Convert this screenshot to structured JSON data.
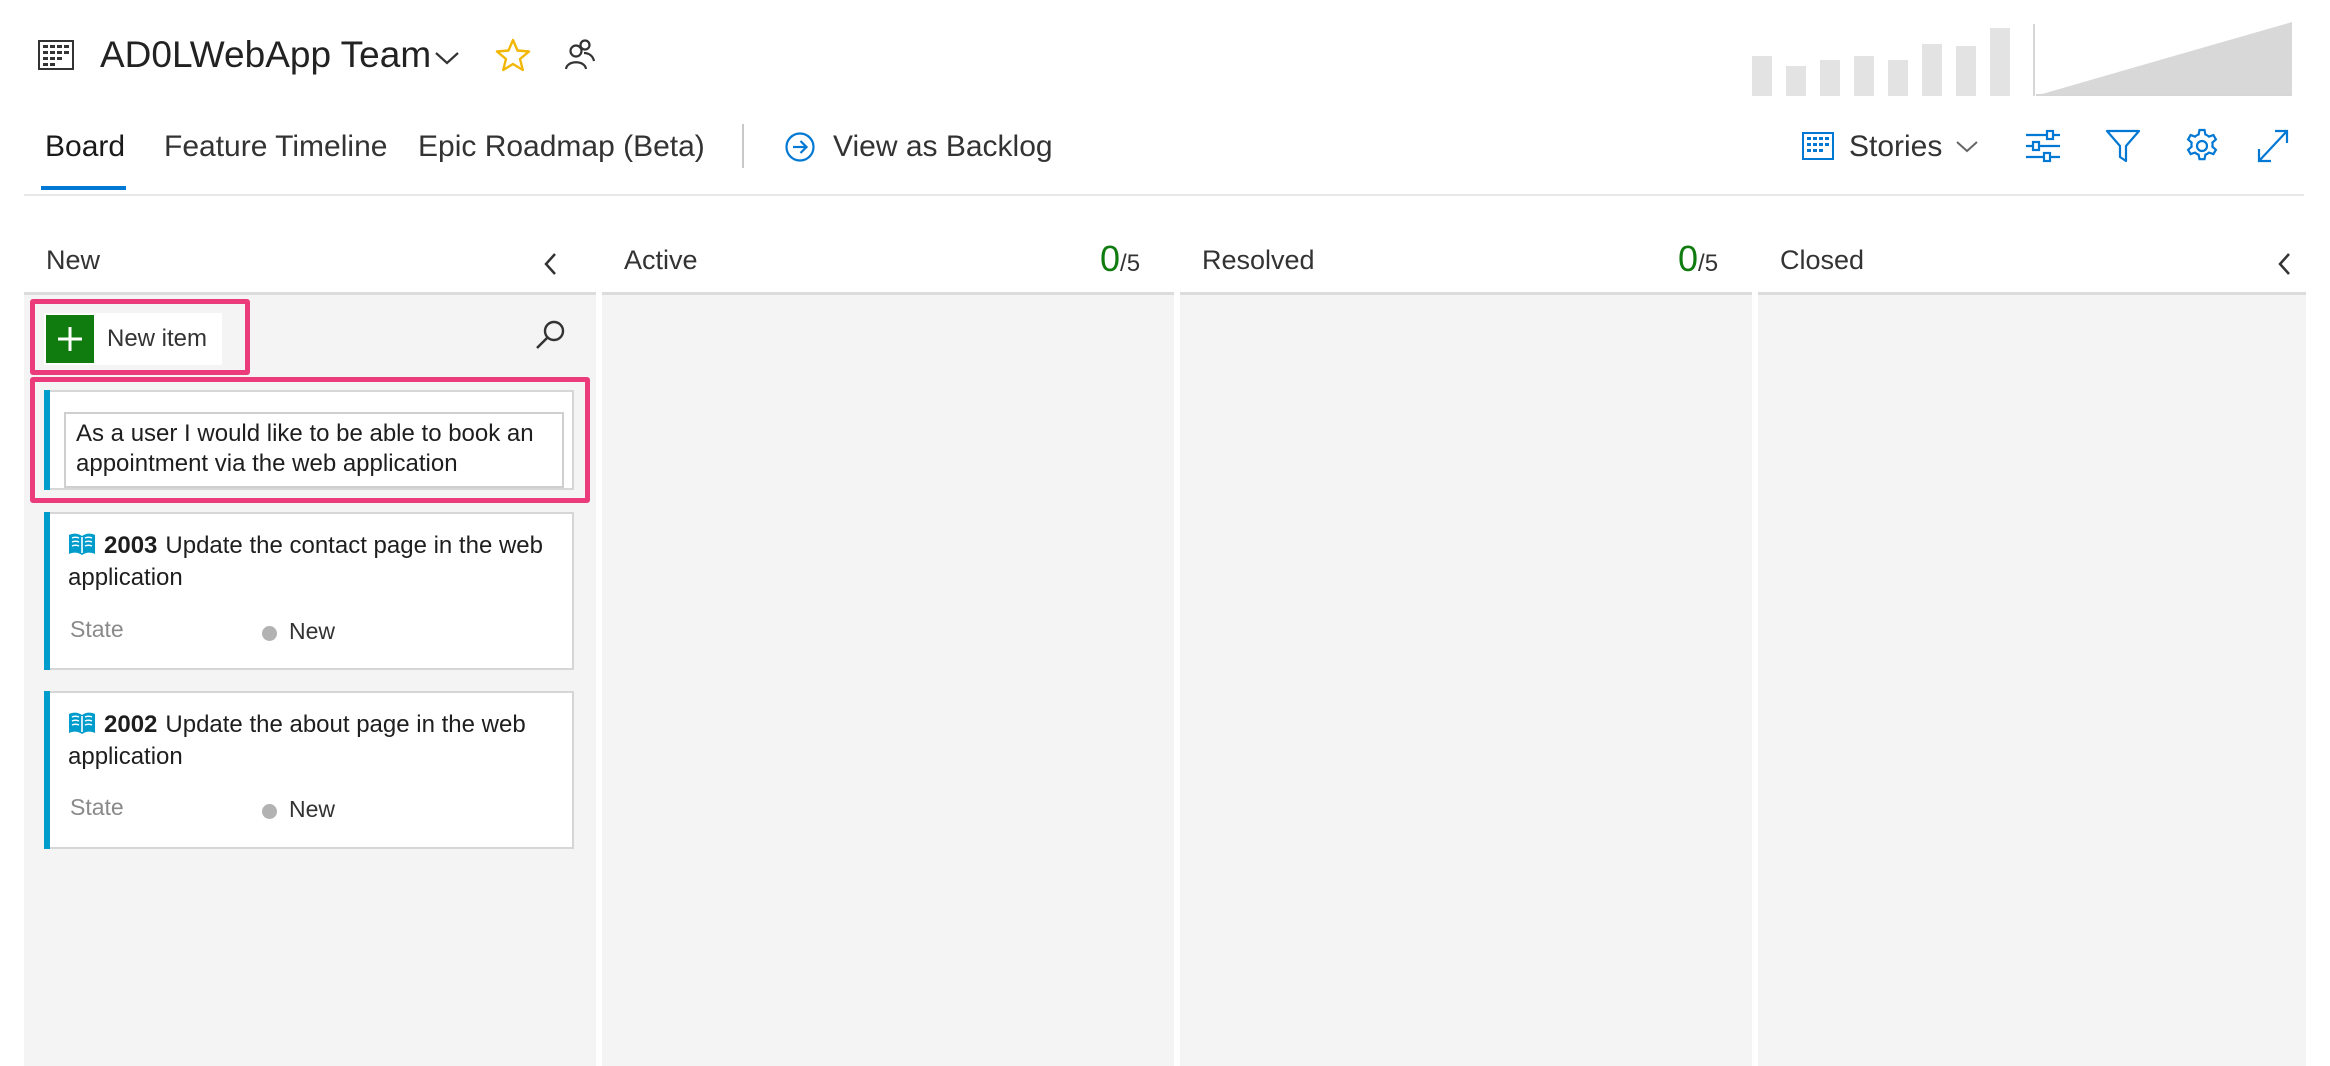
{
  "header": {
    "team_name": "AD0LWebApp Team",
    "icons": {
      "team": "board-grid-icon",
      "chevron": "chevron-down-icon",
      "favorite": "star-icon",
      "members": "team-members-icon"
    },
    "accent_color": "#f2b705"
  },
  "tabs": [
    {
      "label": "Board",
      "selected": true
    },
    {
      "label": "Feature Timeline"
    },
    {
      "label": "Epic Roadmap (Beta)"
    }
  ],
  "view_as_backlog": {
    "label": "View as Backlog",
    "icon": "arrow-circle-right-icon"
  },
  "toolbar": {
    "backlog_level": "Stories",
    "icons": [
      "settings-sliders-icon",
      "filter-icon",
      "gear-icon",
      "fullscreen-expand-icon"
    ],
    "accent_color": "#0078d4"
  },
  "columns": [
    {
      "name": "New"
    },
    {
      "name": "Active",
      "count": "0",
      "limit": "/5"
    },
    {
      "name": "Resolved",
      "count": "0",
      "limit": "/5"
    },
    {
      "name": "Closed"
    }
  ],
  "new_item": {
    "label": "New item",
    "draft_text": "As a user I would like to be able to book an appointment via the web application"
  },
  "cards": [
    {
      "id": "2003",
      "title": "Update the contact page in the web application",
      "field_label": "State",
      "state": "New"
    },
    {
      "id": "2002",
      "title": "Update the about page in the web application",
      "field_label": "State",
      "state": "New"
    }
  ],
  "colors": {
    "in_progress_green": "#107c10",
    "card_accent": "#009ccc",
    "highlight": "#ec3b7a",
    "column_bg": "#f4f4f4"
  }
}
